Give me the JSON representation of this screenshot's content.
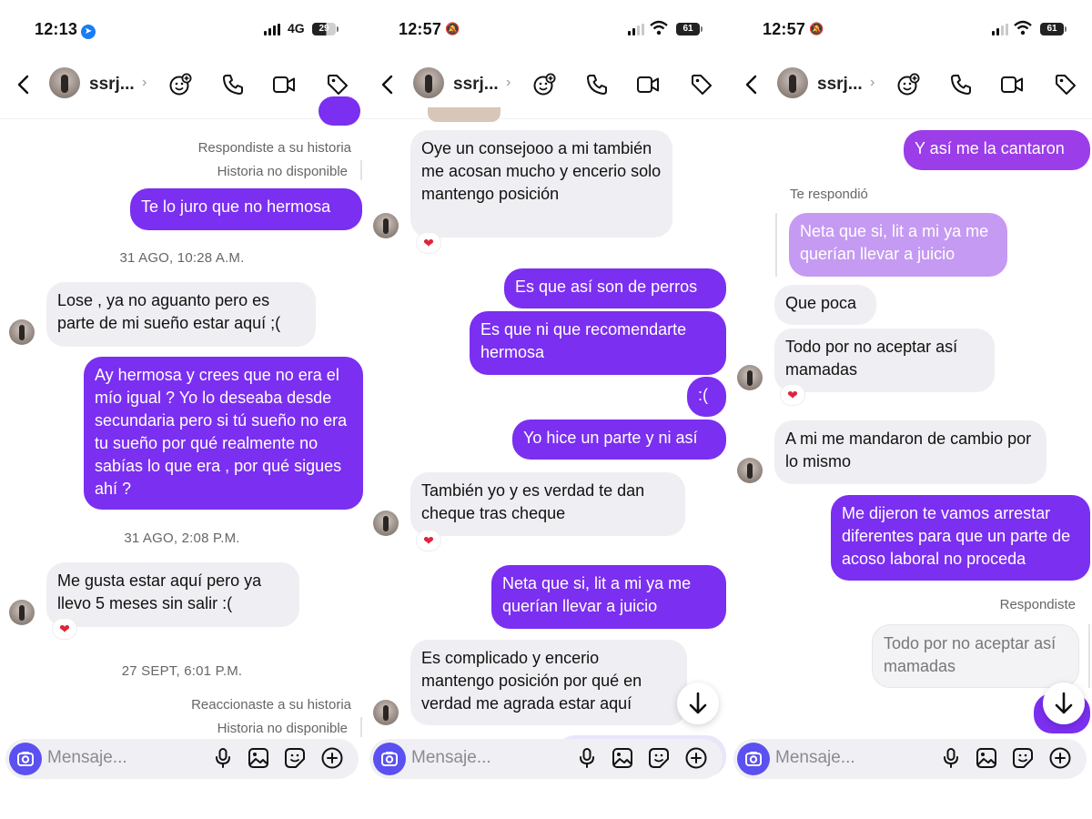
{
  "panels": [
    {
      "status": {
        "time": "12:13",
        "network": "4G",
        "battery": "29"
      },
      "header": {
        "username": "ssrj...",
        "chevron": "›"
      },
      "items": {
        "story_reply_meta": "Respondiste a su historia",
        "story_unavailable_1": "Historia no disponible",
        "msg_1": "Te lo juro que no hermosa",
        "date_1": "31 AGO, 10:28 A.M.",
        "msg_2": "Lose , ya no aguanto pero es parte de mi sueño estar aquí ;(",
        "msg_3": "Ay hermosa y crees que no era el mío igual ? Yo lo deseaba desde secundaria pero si tú sueño no era tu sueño por qué realmente no sabías lo que era , por qué sigues ahí ?",
        "date_2": "31 AGO, 2:08 P.M.",
        "msg_4": "Me gusta estar aquí pero ya llevo 5 meses sin salir :(",
        "date_3": "27 SEPT, 6:01 P.M.",
        "story_react_meta": "Reaccionaste a su historia",
        "story_unavailable_2": "Historia no disponible"
      },
      "composer": {
        "placeholder": "Mensaje..."
      }
    },
    {
      "status": {
        "time": "12:57",
        "battery": "61"
      },
      "header": {
        "username": "ssrj...",
        "chevron": "›"
      },
      "items": {
        "msg_1": "Oye un consejooo a mi también me acosan mucho y encerio solo mantengo posición",
        "msg_2": "Es que así son de perros",
        "msg_3": "Es que ni que recomendarte hermosa",
        "msg_4": ":(",
        "msg_5": "Yo hice un parte y ni así",
        "msg_6": "También yo y es verdad te dan cheque tras cheque",
        "msg_7": "Neta que si, lit a mi ya me querían llevar a juicio",
        "msg_8": "Es complicado y encerio mantengo posición por qué en verdad me agrada estar aquí"
      },
      "composer": {
        "placeholder": "Mensaje..."
      }
    },
    {
      "status": {
        "time": "12:57",
        "battery": "61"
      },
      "header": {
        "username": "ssrj...",
        "chevron": "›"
      },
      "items": {
        "msg_1": "Y así me la cantaron",
        "reply_meta": "Te respondió",
        "quoted": "Neta que si, lit a mi ya me querían llevar a juicio",
        "msg_2": "Que poca",
        "msg_3": "Todo por no aceptar así mamadas",
        "msg_4": "A mi me mandaron de cambio por lo mismo",
        "msg_5": "Me dijeron te vamos arrestar diferentes para que un parte de acoso laboral no proceda",
        "reply_meta_2": "Respondiste",
        "quoted_2": "Todo por no aceptar así mamadas"
      },
      "composer": {
        "placeholder": "Mensaje..."
      }
    }
  ],
  "icons": {
    "back": "back-arrow-icon",
    "sticker_plus": "sticker-plus-icon",
    "phone": "phone-icon",
    "video": "video-camera-icon",
    "tag": "tag-icon",
    "camera": "camera-icon",
    "mic": "microphone-icon",
    "gallery": "gallery-icon",
    "sticker": "sticker-icon",
    "plus": "plus-circle-icon",
    "scroll_down": "arrow-down-icon",
    "heart": "heart-icon"
  },
  "colors": {
    "outgoing": "#7b2ff0",
    "incoming": "#efeff3",
    "camera_button": "#5b50f0",
    "heart": "#e0243a"
  }
}
